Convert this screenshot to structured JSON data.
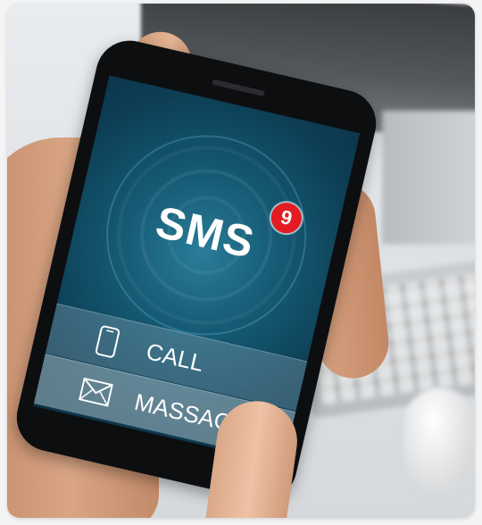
{
  "screen": {
    "main_label": "SMS",
    "badge_count": "9",
    "menu": [
      {
        "label": "CALL",
        "icon": "phone-icon"
      },
      {
        "label": "MASSAGE",
        "icon": "envelope-icon"
      }
    ]
  },
  "colors": {
    "screen_accent": "#155a74",
    "badge": "#e21c22"
  }
}
